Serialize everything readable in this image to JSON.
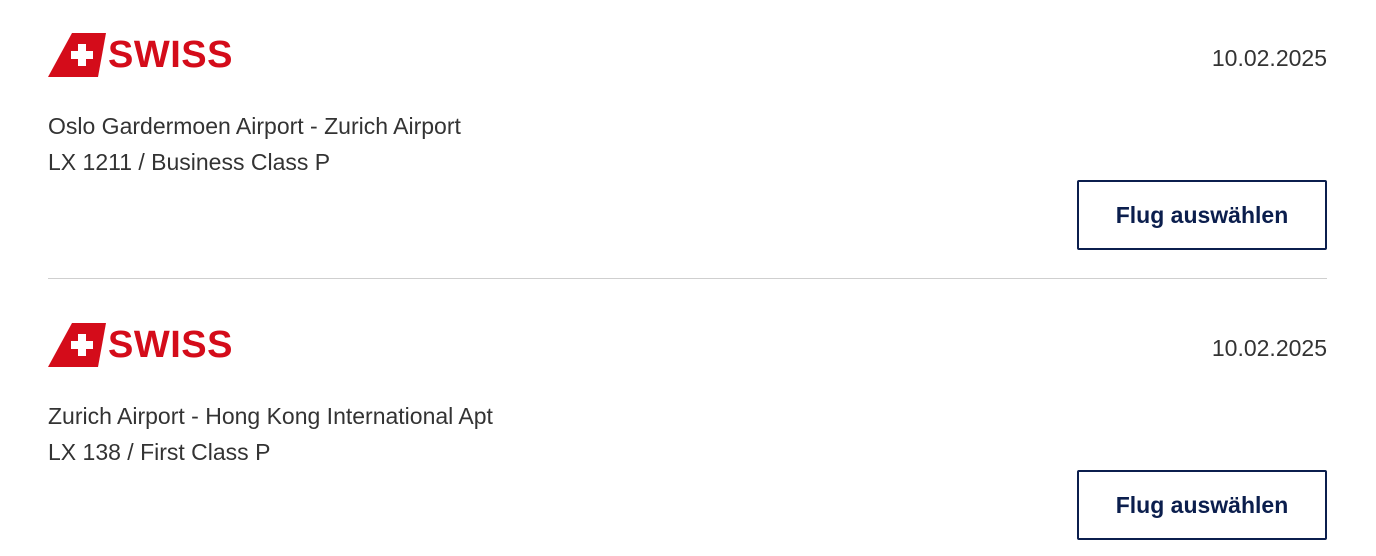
{
  "brand": {
    "name": "SWISS",
    "color": "#d40c1a",
    "icon": "swiss-tail-cross-icon"
  },
  "button_color": "#0b1e4d",
  "flights": [
    {
      "airline": "SWISS",
      "date": "10.02.2025",
      "route": "Oslo Gardermoen Airport - Zurich Airport",
      "flight_info": "LX 1211 / Business Class P",
      "button_label": "Flug auswählen"
    },
    {
      "airline": "SWISS",
      "date": "10.02.2025",
      "route": "Zurich Airport - Hong Kong International Apt",
      "flight_info": "LX 138 / First Class P",
      "button_label": "Flug auswählen"
    }
  ]
}
